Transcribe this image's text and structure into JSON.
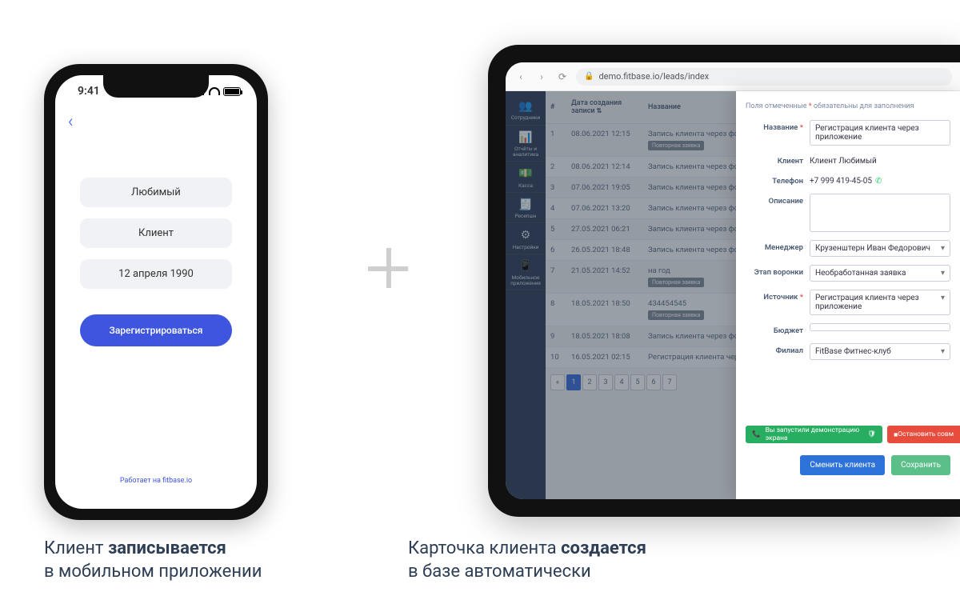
{
  "phone": {
    "time": "9:41",
    "field_surname": "Любимый",
    "field_name": "Клиент",
    "field_dob": "12 апреля 1990",
    "cta": "Зарегистрироваться",
    "footer": "Работает на fitbase.io"
  },
  "tablet": {
    "url": "demo.fitbase.io/leads/index",
    "sidebar": [
      {
        "icon": "👥",
        "label": "Сотрудники"
      },
      {
        "icon": "📊",
        "label": "Отчёты и аналитика"
      },
      {
        "icon": "💵",
        "label": "Касса"
      },
      {
        "icon": "🧾",
        "label": "Ресепшн"
      },
      {
        "icon": "⚙",
        "label": "Настройки"
      },
      {
        "icon": "📱",
        "label": "Мобильное приложение"
      }
    ],
    "table": {
      "col_num": "#",
      "col_date": "Дата создания записи",
      "col_name": "Название",
      "badge_repeat": "Повторная заявка",
      "rows": [
        {
          "n": "1",
          "d": "08.06.2021 12:15",
          "t": "Запись клиента через форму расписания тренировок",
          "badge": true
        },
        {
          "n": "2",
          "d": "08.06.2021 12:14",
          "t": "Запись клиента через форму расписания тренировок",
          "badge": false
        },
        {
          "n": "3",
          "d": "07.06.2021 19:05",
          "t": "Запись клиента через форму расписания тренировок",
          "badge": false
        },
        {
          "n": "4",
          "d": "07.06.2021 13:20",
          "t": "Запись клиента через форму расписания тренировок",
          "badge": false
        },
        {
          "n": "5",
          "d": "27.05.2021 06:21",
          "t": "Запись клиента через форму расписания тренировок",
          "badge": false
        },
        {
          "n": "6",
          "d": "26.05.2021 18:48",
          "t": "Запись клиента через форму расписания тренировок",
          "badge": false
        },
        {
          "n": "7",
          "d": "21.05.2021 14:52",
          "t": "на год",
          "badge": true
        },
        {
          "n": "8",
          "d": "18.05.2021 18:50",
          "t": "434454545",
          "badge": true
        },
        {
          "n": "9",
          "d": "18.05.2021 18:08",
          "t": "Запись клиента через форму расписания тренировок",
          "badge": false
        },
        {
          "n": "10",
          "d": "16.05.2021 02:15",
          "t": "Регистрация клиента через приложение",
          "badge": false
        }
      ],
      "pages": [
        "«",
        "1",
        "2",
        "3",
        "4",
        "5",
        "6",
        "7"
      ]
    },
    "form": {
      "required_note_pre": "Поля отмеченные ",
      "required_note_post": " обязательны для заполнения",
      "label_name": "Название",
      "val_name": "Регистрация клиента через приложение",
      "label_client": "Клиент",
      "val_client": "Клиент Любимый",
      "label_phone": "Телефон",
      "val_phone": "+7 999 419-45-05",
      "label_desc": "Описание",
      "label_manager": "Менеджер",
      "val_manager": "Крузенштерн Иван Федорович",
      "label_stage": "Этап воронки",
      "val_stage": "Необработанная заявка",
      "label_source": "Источник",
      "val_source": "Регистрация клиента через приложение",
      "label_budget": "Бюджет",
      "label_branch": "Филиал",
      "val_branch": "FitBase Фитнес-клуб",
      "demo_text": "Вы запустили демонстрацию экрана",
      "demo_stop": "Остановить совм",
      "btn_change": "Сменить клиента",
      "btn_save": "Сохранить"
    }
  },
  "captions": {
    "left_pre": "Клиент ",
    "left_bold": "записывается",
    "left_post": "в мобильном приложении",
    "right_pre": "Карточка клиента ",
    "right_bold": "создается",
    "right_post": "в базе автоматически"
  }
}
